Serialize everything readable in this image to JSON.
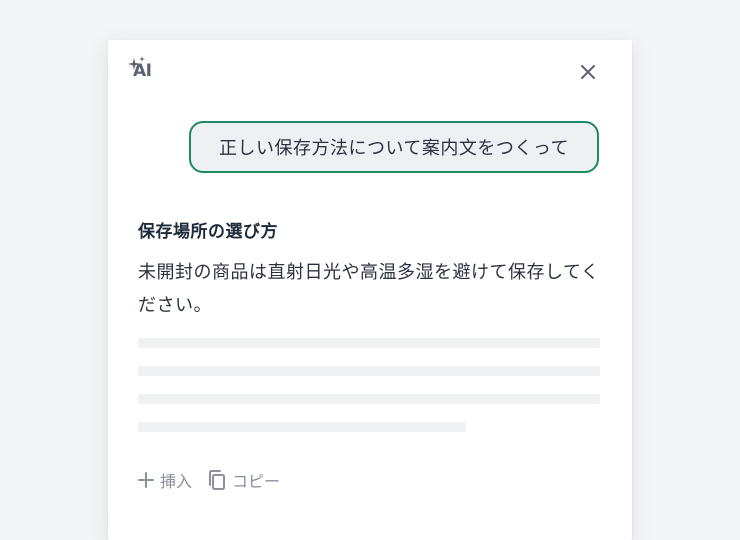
{
  "panel": {
    "logo_text": "AI",
    "logo_icon": "sparkle-icon",
    "close_icon": "close-icon"
  },
  "prompt": {
    "text": "正しい保存方法について案内文をつくって"
  },
  "response": {
    "title": "保存場所の選び方",
    "body": "未開封の商品は直射日光や高温多湿を避けて保存してください。"
  },
  "actions": {
    "insert_label": "挿入",
    "insert_icon": "plus-icon",
    "copy_label": "コピー",
    "copy_icon": "copy-icon"
  },
  "colors": {
    "accent_border": "#1f8a62",
    "bubble_bg": "#eef1f4",
    "skeleton": "#eff1f3",
    "muted_text": "#8a919c"
  }
}
